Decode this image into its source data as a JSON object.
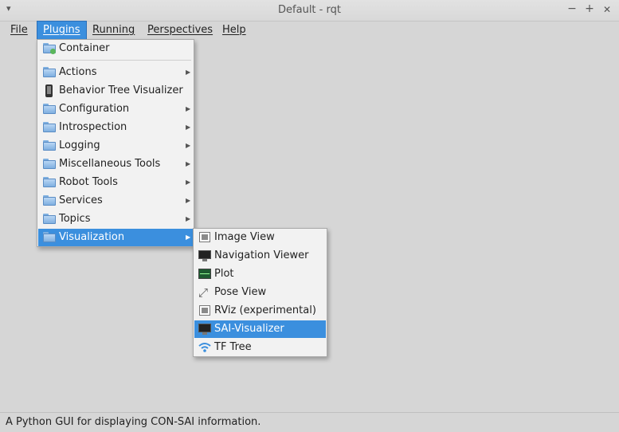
{
  "window": {
    "title": "Default - rqt",
    "controls": {
      "minimize": "−",
      "maximize": "+",
      "close": "✕"
    }
  },
  "menubar": {
    "items": [
      {
        "label": "File"
      },
      {
        "label": "Plugins"
      },
      {
        "label": "Running"
      },
      {
        "label": "Perspectives"
      },
      {
        "label": "Help"
      }
    ]
  },
  "plugins_menu": {
    "items": [
      {
        "label": "Container",
        "icon": "container-folder-icon"
      },
      {
        "label": "Actions",
        "icon": "folder-icon",
        "submenu": true
      },
      {
        "label": "Behavior Tree Visualizer",
        "icon": "phone-icon"
      },
      {
        "label": "Configuration",
        "icon": "folder-icon",
        "submenu": true
      },
      {
        "label": "Introspection",
        "icon": "folder-icon",
        "submenu": true
      },
      {
        "label": "Logging",
        "icon": "folder-icon",
        "submenu": true
      },
      {
        "label": "Miscellaneous Tools",
        "icon": "folder-icon",
        "submenu": true
      },
      {
        "label": "Robot Tools",
        "icon": "folder-icon",
        "submenu": true
      },
      {
        "label": "Services",
        "icon": "folder-icon",
        "submenu": true
      },
      {
        "label": "Topics",
        "icon": "folder-icon",
        "submenu": true
      },
      {
        "label": "Visualization",
        "icon": "folder-icon",
        "submenu": true,
        "highlighted": true
      }
    ]
  },
  "visualization_menu": {
    "items": [
      {
        "label": "Image View",
        "icon": "image-icon"
      },
      {
        "label": "Navigation Viewer",
        "icon": "monitor-icon"
      },
      {
        "label": "Plot",
        "icon": "plot-icon"
      },
      {
        "label": "Pose View",
        "icon": "arrows-icon"
      },
      {
        "label": "RViz (experimental)",
        "icon": "image-icon"
      },
      {
        "label": "SAI-Visualizer",
        "icon": "monitor-icon",
        "highlighted": true
      },
      {
        "label": "TF Tree",
        "icon": "wifi-icon"
      }
    ]
  },
  "statusbar": {
    "text": "A Python GUI for displaying CON-SAI information."
  },
  "colors": {
    "highlight": "#3b8fde",
    "window_bg": "#d6d6d6",
    "menu_bg": "#f2f2f2"
  }
}
